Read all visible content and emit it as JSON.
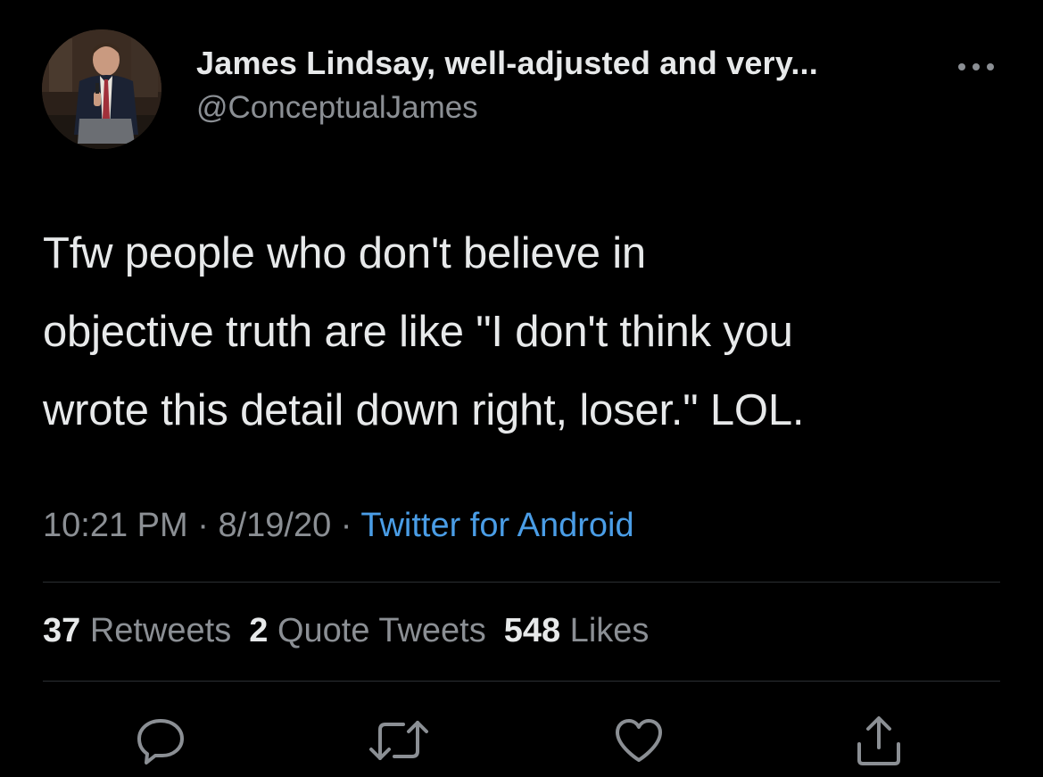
{
  "author": {
    "display_name": "James Lindsay, well-adjusted and very...",
    "handle": "@ConceptualJames"
  },
  "tweet": {
    "text": "Tfw people who don't believe in\nobjective truth are like \"I don't think you\nwrote this detail down right, loser.\" LOL.",
    "time": "10:21 PM",
    "separator": " · ",
    "date": "8/19/20",
    "source": "Twitter for Android"
  },
  "stats": {
    "retweets_count": "37",
    "retweets_label": " Retweets",
    "quotes_count": "2",
    "quotes_label": " Quote Tweets",
    "likes_count": "548",
    "likes_label": " Likes"
  },
  "icons": {
    "more": "more-icon",
    "reply": "reply-icon",
    "retweet": "retweet-icon",
    "like": "heart-icon",
    "share": "share-icon"
  },
  "colors": {
    "background": "#000000",
    "primary_text": "#e7e9ea",
    "secondary_text": "#8b8f94",
    "link": "#4a9de6",
    "icon": "#8b8f94"
  }
}
